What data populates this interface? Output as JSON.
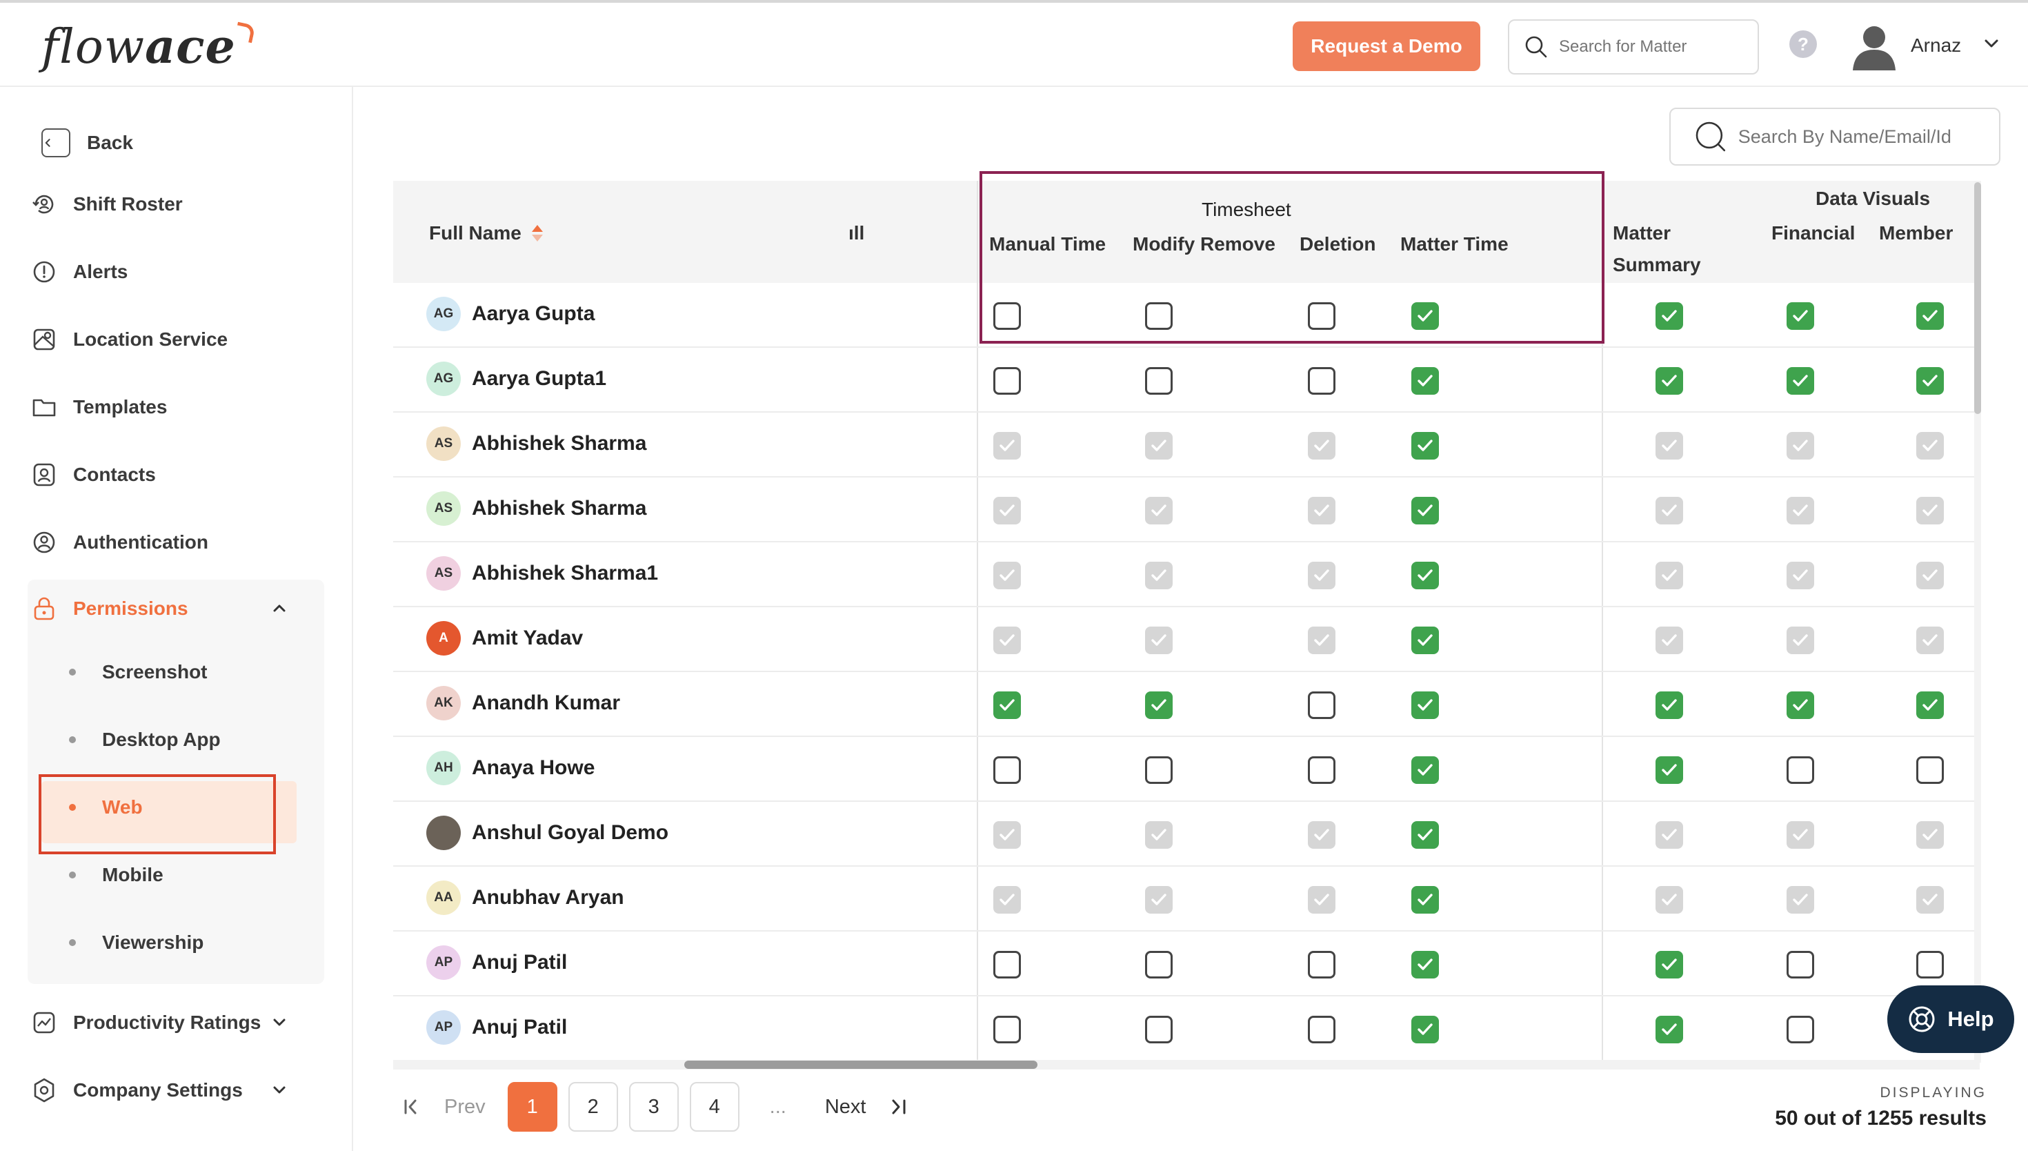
{
  "header": {
    "logo_prefix": "flow",
    "logo_suffix": "ace",
    "demo_label": "Request a Demo",
    "search_placeholder": "Search for Matter",
    "help_icon_text": "?",
    "user_name": "Arnaz"
  },
  "sidebar": {
    "back_label": "Back",
    "items": [
      {
        "label": "Shift Roster",
        "icon": "shift-roster-icon"
      },
      {
        "label": "Alerts",
        "icon": "alert-icon"
      },
      {
        "label": "Location Service",
        "icon": "location-icon"
      },
      {
        "label": "Templates",
        "icon": "folder-icon"
      },
      {
        "label": "Contacts",
        "icon": "contact-icon"
      },
      {
        "label": "Authentication",
        "icon": "authentication-icon"
      }
    ],
    "permissions_label": "Permissions",
    "permissions_sub": [
      "Screenshot",
      "Desktop App",
      "Web",
      "Mobile",
      "Viewership"
    ],
    "productivity_label": "Productivity Ratings",
    "company_label": "Company Settings"
  },
  "main": {
    "search_placeholder": "Search By Name/Email/Id"
  },
  "table": {
    "full_name_header": "Full Name",
    "clipped_header": "ıll",
    "timesheet_group": "Timesheet",
    "timesheet_cols": [
      "Manual Time",
      "Modify Remove",
      "Deletion",
      "Matter Time"
    ],
    "matter_summary_line1": "Matter",
    "matter_summary_line2": "Summary",
    "data_visuals_group": "Data Visuals",
    "data_visuals_cols": [
      "Financial",
      "Member"
    ],
    "rows": [
      {
        "initials": "AG",
        "avatar_color": "#d4e9f5",
        "name": "Aarya Gupta",
        "states": [
          "off",
          "off",
          "off",
          "on",
          "on",
          "on",
          "on"
        ]
      },
      {
        "initials": "AG",
        "avatar_color": "#cdeedd",
        "name": "Aarya Gupta1",
        "states": [
          "off",
          "off",
          "off",
          "on",
          "on",
          "on",
          "on"
        ]
      },
      {
        "initials": "AS",
        "avatar_color": "#f1e0c4",
        "name": "Abhishek Sharma",
        "states": [
          "dis",
          "dis",
          "dis",
          "on",
          "dis",
          "dis",
          "dis"
        ]
      },
      {
        "initials": "AS",
        "avatar_color": "#d7f0d2",
        "name": "Abhishek Sharma",
        "states": [
          "dis",
          "dis",
          "dis",
          "on",
          "dis",
          "dis",
          "dis"
        ]
      },
      {
        "initials": "AS",
        "avatar_color": "#f0d0e0",
        "name": "Abhishek Sharma1",
        "states": [
          "dis",
          "dis",
          "dis",
          "on",
          "dis",
          "dis",
          "dis"
        ]
      },
      {
        "initials": "A",
        "avatar_color": "#e4572e",
        "name": "Amit Yadav",
        "states": [
          "dis",
          "dis",
          "dis",
          "on",
          "dis",
          "dis",
          "dis"
        ]
      },
      {
        "initials": "AK",
        "avatar_color": "#efd2cc",
        "name": "Anandh Kumar",
        "states": [
          "on",
          "on",
          "off",
          "on",
          "on",
          "on",
          "on"
        ]
      },
      {
        "initials": "AH",
        "avatar_color": "#cdeedd",
        "name": "Anaya Howe",
        "states": [
          "off",
          "off",
          "off",
          "on",
          "on",
          "off",
          "off"
        ]
      },
      {
        "initials": "",
        "avatar_color": "#6b6258",
        "name": "Anshul Goyal Demo",
        "states": [
          "dis",
          "dis",
          "dis",
          "on",
          "dis",
          "dis",
          "dis"
        ]
      },
      {
        "initials": "AA",
        "avatar_color": "#f3ebc5",
        "name": "Anubhav Aryan",
        "states": [
          "dis",
          "dis",
          "dis",
          "on",
          "dis",
          "dis",
          "dis"
        ]
      },
      {
        "initials": "AP",
        "avatar_color": "#ecd0ec",
        "name": "Anuj Patil",
        "states": [
          "off",
          "off",
          "off",
          "on",
          "on",
          "off",
          "off"
        ]
      },
      {
        "initials": "AP",
        "avatar_color": "#cfe0f3",
        "name": "Anuj Patil",
        "states": [
          "off",
          "off",
          "off",
          "on",
          "on",
          "off",
          "off"
        ]
      }
    ]
  },
  "pagination": {
    "prev_label": "Prev",
    "next_label": "Next",
    "pages": [
      "1",
      "2",
      "3",
      "4"
    ],
    "ellipsis": "...",
    "current_page": "1",
    "display_label": "DISPLAYING",
    "display_value": "50 out of 1255 results"
  },
  "help_button_label": "Help",
  "colors": {
    "accent": "#f0703f",
    "checked": "#3fa34d",
    "disabled": "#d6d6d6",
    "timesheet_highlight": "#8b2252",
    "web_highlight": "#d9432b",
    "help_button": "#142c44"
  }
}
